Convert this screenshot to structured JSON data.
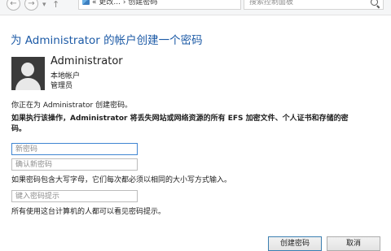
{
  "nav": {
    "back_icon": "back-arrow-icon",
    "forward_icon": "forward-arrow-icon",
    "dropdown_icon": "chevron-down-icon",
    "up_icon": "up-arrow-icon",
    "address": {
      "icon": "control-panel-icon",
      "prefix": "«",
      "path_parent": "更改...",
      "separator": "›",
      "path_current": "创建密码"
    },
    "search_placeholder": "搜索控制面板",
    "search_icon": "search-icon"
  },
  "page": {
    "title": "为 Administrator 的帐户创建一个密码"
  },
  "account": {
    "name": "Administrator",
    "type": "本地帐户",
    "role": "管理员"
  },
  "intro_text": "你正在为 Administrator 创建密码。",
  "warning": {
    "line1": "如果执行该操作，Administrator 将丢失网站或网络资源的所有 EFS 加密文件、个人证书和存储的密",
    "line2": "码。"
  },
  "form": {
    "new_password_placeholder": "新密码",
    "confirm_password_placeholder": "确认新密码",
    "case_hint": "如果密码包含大写字母，它们每次都必须以相同的大小写方式输入。",
    "hint_placeholder": "键入密码提示",
    "hint_note": "所有使用这台计算机的人都可以看见密码提示。"
  },
  "buttons": {
    "create": "创建密码",
    "cancel": "取消"
  }
}
